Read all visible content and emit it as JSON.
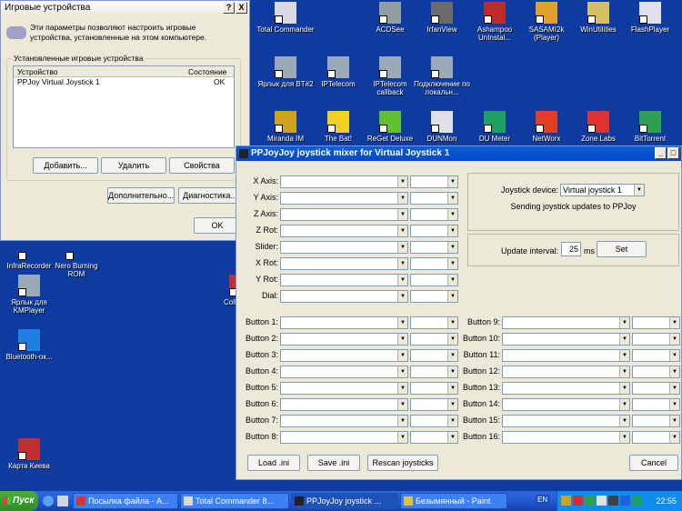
{
  "desktop_icons": [
    {
      "label": "Total Commander",
      "color": "#d8d8e0"
    },
    {
      "label": "ACDSee",
      "color": "#8fa0a0"
    },
    {
      "label": "IrfanView",
      "color": "#6a6a6a"
    },
    {
      "label": "Ashampoo UnInstal...",
      "color": "#c02a2a"
    },
    {
      "label": "SASAMI2k (Player)",
      "color": "#e0a030"
    },
    {
      "label": "WinUtilities",
      "color": "#d8c060"
    },
    {
      "label": "FlashPlayer",
      "color": "#e0e0e8"
    },
    {
      "label": "Ярлык для BT#2",
      "color": "#9aa8b8"
    },
    {
      "label": "IPTelecom",
      "color": "#9aa8b8"
    },
    {
      "label": "IPTelecom callback",
      "color": "#9aa8b8"
    },
    {
      "label": "Подключение по локальн...",
      "color": "#9aa8b8"
    },
    {
      "label": "Miranda IM",
      "color": "#d0a020"
    },
    {
      "label": "The Bat!",
      "color": "#f0d020"
    },
    {
      "label": "ReGet Deluxe",
      "color": "#60c030"
    },
    {
      "label": "DUNMon",
      "color": "#e0e0e8"
    },
    {
      "label": "DU Meter",
      "color": "#20a060"
    },
    {
      "label": "NetWorx",
      "color": "#e04020"
    },
    {
      "label": "Zone Labs",
      "color": "#e03030"
    },
    {
      "label": "BitTorrent",
      "color": "#30a050"
    },
    {
      "label": "InfraRecorder",
      "color": "#0d3ba0"
    },
    {
      "label": "Nero Burning ROM",
      "color": "#0d3ba0"
    },
    {
      "label": "Ярлык для KMPlayer",
      "color": "#9aa8b8"
    },
    {
      "label": "Bluetooth-ок...",
      "color": "#2080e0"
    },
    {
      "label": "Coll Dictio",
      "color": "#c03030"
    },
    {
      "label": "Карта Киева",
      "color": "#c03030"
    }
  ],
  "game_controllers": {
    "title": "Игровые устройства",
    "description": "Эти параметры позволяют настроить игровые устройства, установленные на этом компьютере.",
    "group_label": "Установленные игровые устройства",
    "col_device": "Устройство",
    "col_status": "Состояние",
    "rows": [
      {
        "device": "PPJoy Virtual Joystick 1",
        "status": "OK"
      }
    ],
    "btn_add": "Добавить...",
    "btn_remove": "Удалить",
    "btn_properties": "Свойства",
    "btn_advanced": "Дополнительно...",
    "btn_diagnostics": "Диагностика...",
    "btn_ok": "OK",
    "help_btn": "?",
    "close_btn": "X"
  },
  "mixer": {
    "title": "PPJoyJoy joystick mixer for Virtual Joystick 1",
    "axes": [
      "X Axis:",
      "Y Axis:",
      "Z Axis:",
      "Z Rot:",
      "Slider:",
      "X Rot:",
      "Y Rot:",
      "Dial:"
    ],
    "buttons_left": [
      "Button 1:",
      "Button 2:",
      "Button 3:",
      "Button 4:",
      "Button 5:",
      "Button 6:",
      "Button 7:",
      "Button 8:"
    ],
    "buttons_right": [
      "Button 9:",
      "Button 10:",
      "Button 11:",
      "Button 12:",
      "Button 13:",
      "Button 14:",
      "Button 15:",
      "Button 16:"
    ],
    "device_label": "Joystick device:",
    "device_value": "Virtual joystick 1",
    "status": "Sending joystick updates to PPJoy",
    "interval_label": "Update interval:",
    "interval_value": "25",
    "interval_unit": "ms",
    "btn_set": "Set",
    "btn_load": "Load .ini",
    "btn_save": "Save .ini",
    "btn_rescan": "Rescan joysticks",
    "btn_cancel": "Cancel"
  },
  "taskbar": {
    "start": "Пуск",
    "tasks": [
      {
        "label": "Посылка файла - A...",
        "active": false
      },
      {
        "label": "Total Commander 8...",
        "active": false
      },
      {
        "label": "PPJoyJoy joystick ...",
        "active": true
      },
      {
        "label": "Безымянный - Paint",
        "active": false
      }
    ],
    "lang": "EN",
    "clock": "22:55"
  }
}
